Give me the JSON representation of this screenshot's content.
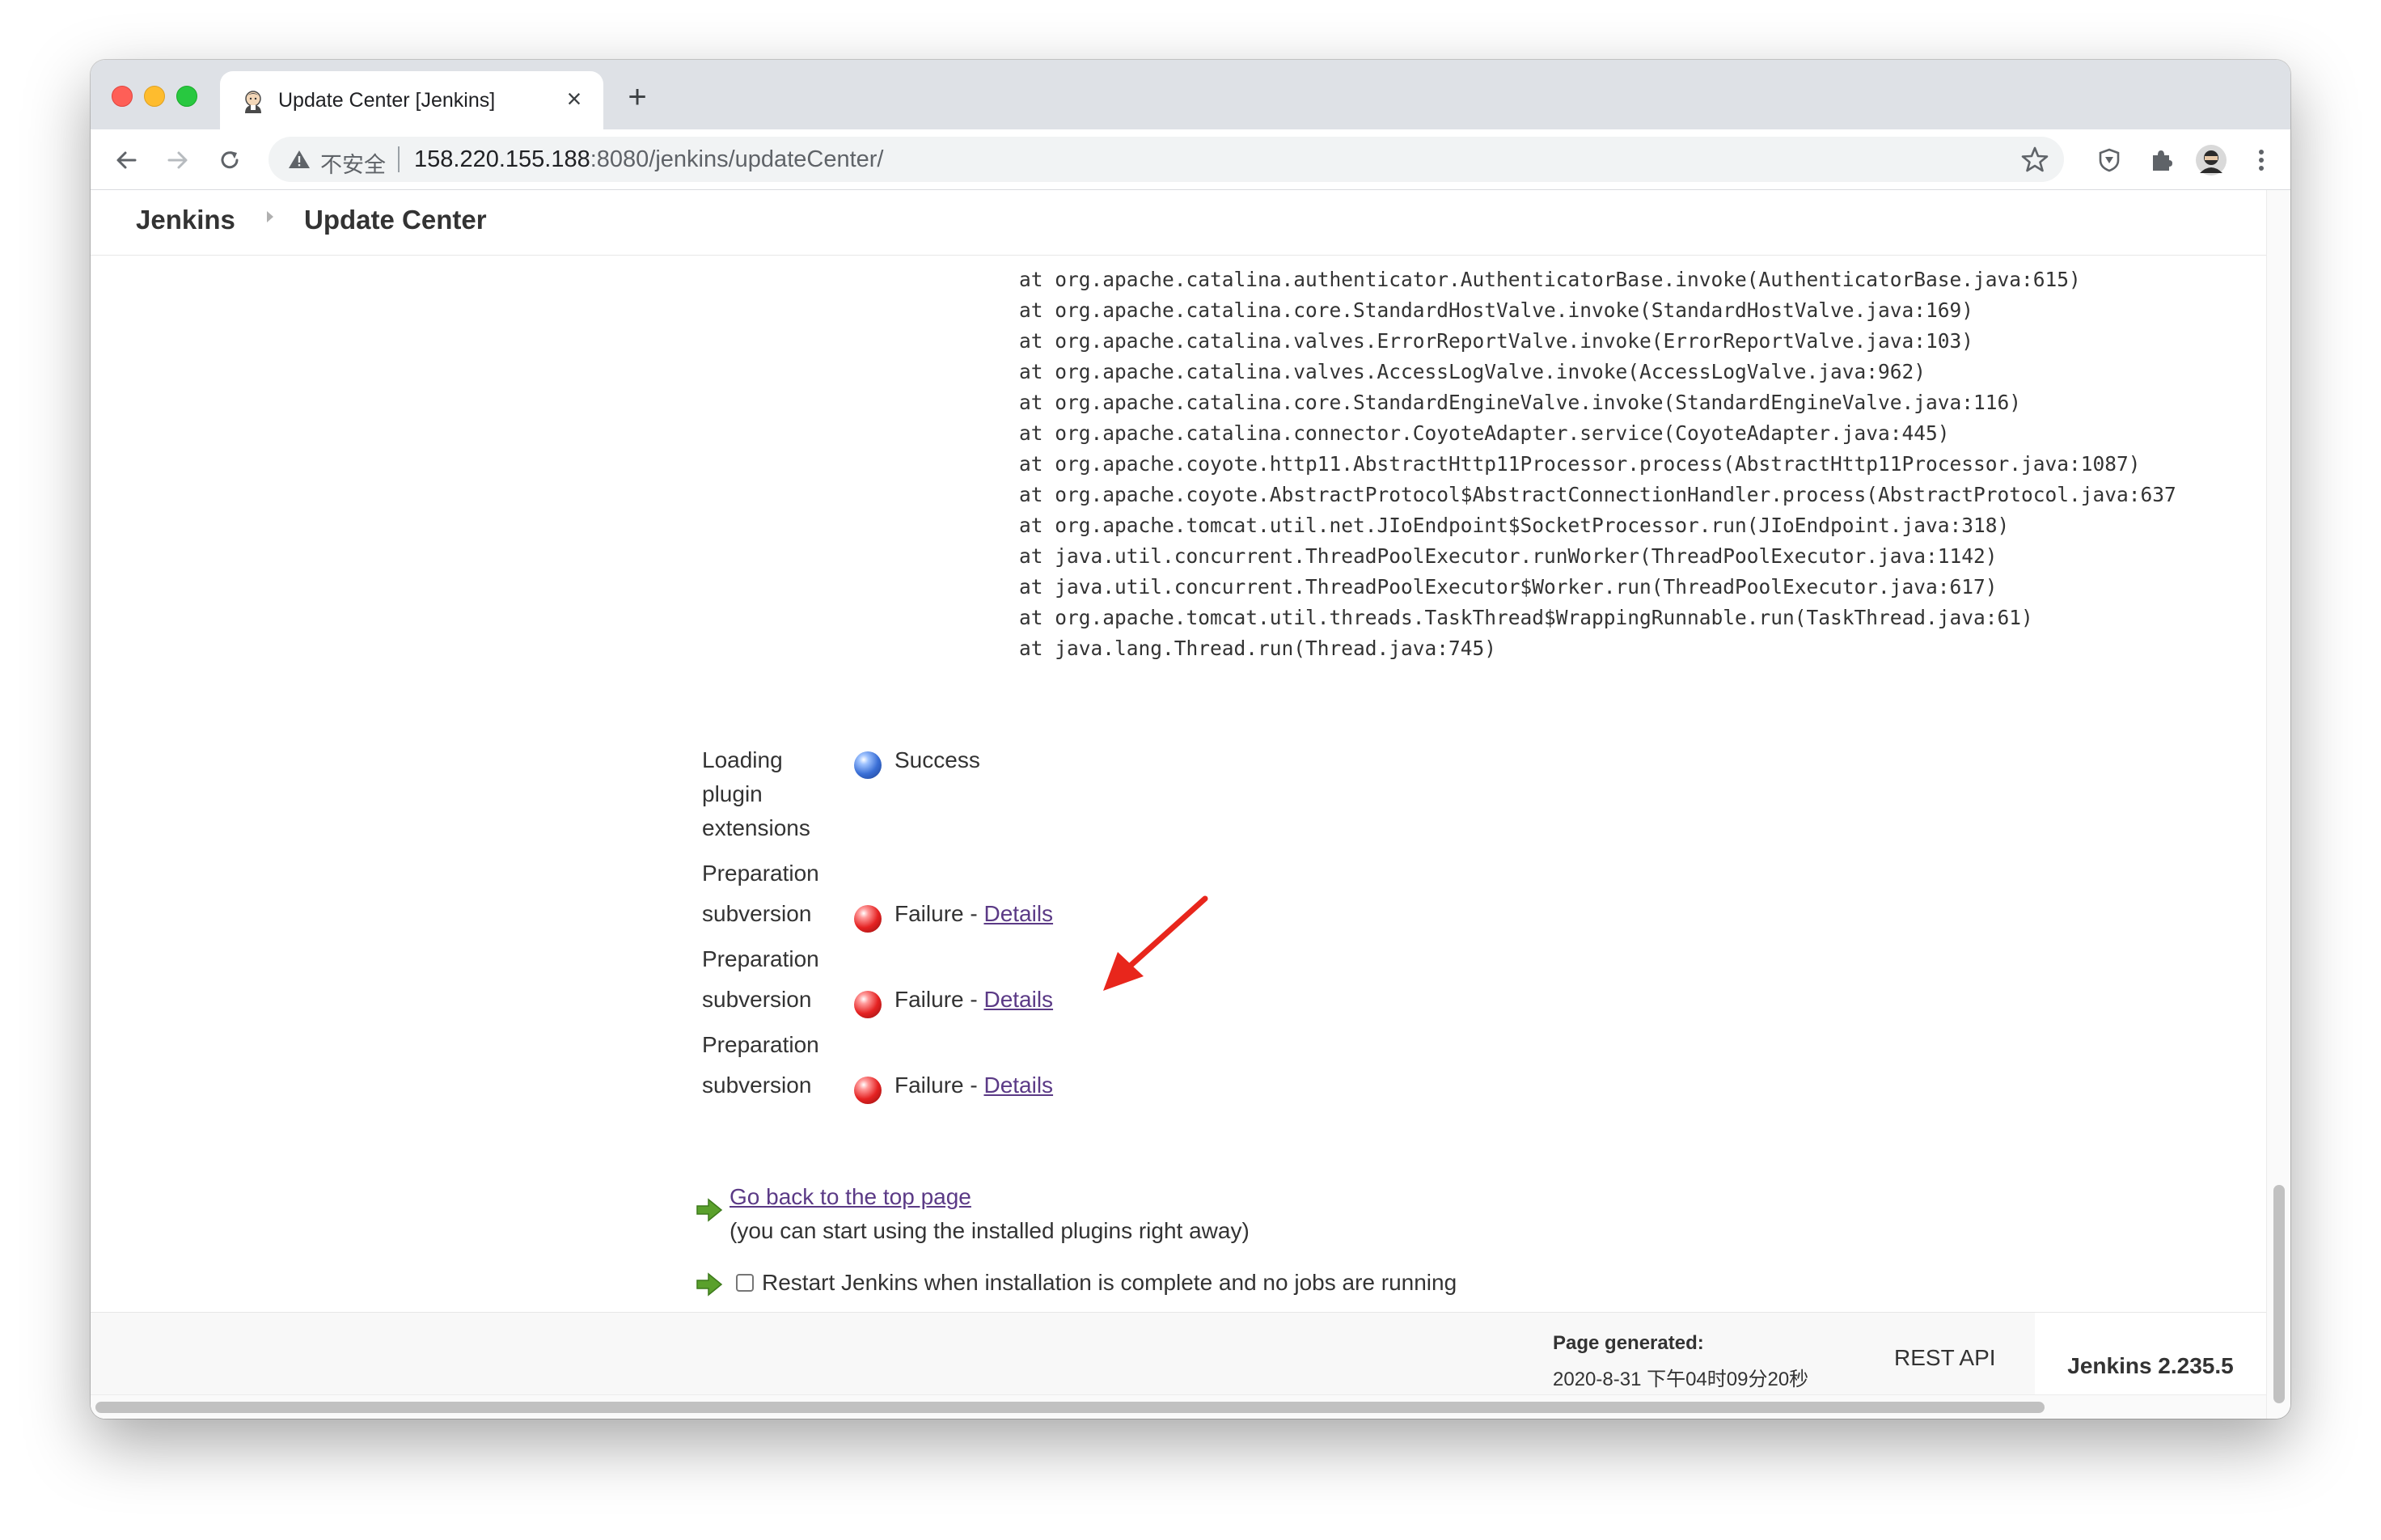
{
  "browser": {
    "tab_title": "Update Center [Jenkins]",
    "security_label": "不安全",
    "url_host": "158.220.155.188",
    "url_rest": ":8080/jenkins/updateCenter/"
  },
  "breadcrumb": {
    "root": "Jenkins",
    "current": "Update Center"
  },
  "stack_trace": "at org.apache.catalina.authenticator.AuthenticatorBase.invoke(AuthenticatorBase.java:615)\nat org.apache.catalina.core.StandardHostValve.invoke(StandardHostValve.java:169)\nat org.apache.catalina.valves.ErrorReportValve.invoke(ErrorReportValve.java:103)\nat org.apache.catalina.valves.AccessLogValve.invoke(AccessLogValve.java:962)\nat org.apache.catalina.core.StandardEngineValve.invoke(StandardEngineValve.java:116)\nat org.apache.catalina.connector.CoyoteAdapter.service(CoyoteAdapter.java:445)\nat org.apache.coyote.http11.AbstractHttp11Processor.process(AbstractHttp11Processor.java:1087)\nat org.apache.coyote.AbstractProtocol$AbstractConnectionHandler.process(AbstractProtocol.java:637\nat org.apache.tomcat.util.net.JIoEndpoint$SocketProcessor.run(JIoEndpoint.java:318)\nat java.util.concurrent.ThreadPoolExecutor.runWorker(ThreadPoolExecutor.java:1142)\nat java.util.concurrent.ThreadPoolExecutor$Worker.run(ThreadPoolExecutor.java:617)\nat org.apache.tomcat.util.threads.TaskThread$WrappingRunnable.run(TaskThread.java:61)\nat java.lang.Thread.run(Thread.java:745)",
  "jobs": {
    "loading": {
      "label_lines": [
        "Loading",
        "plugin",
        "extensions"
      ],
      "status": "Success",
      "status_color": "blue"
    },
    "failures": [
      {
        "label_top": "Preparation",
        "label_bottom": "subversion",
        "status": "Failure - ",
        "link": "Details",
        "status_color": "red"
      },
      {
        "label_top": "Preparation",
        "label_bottom": "subversion",
        "status": "Failure - ",
        "link": "Details",
        "status_color": "red"
      },
      {
        "label_top": "Preparation",
        "label_bottom": "subversion",
        "status": "Failure - ",
        "link": "Details",
        "status_color": "red"
      }
    ]
  },
  "actions": {
    "top_page_link": "Go back to the top page",
    "top_page_note": "(you can start using the installed plugins right away)",
    "restart_label": "Restart Jenkins when installation is complete and no jobs are running",
    "restart_checked": false
  },
  "footer": {
    "generated_label": "Page generated:",
    "generated_value": "2020-8-31 下午04时09分20秒",
    "rest_api": "REST API",
    "version": "Jenkins 2.235.5"
  },
  "colors": {
    "link": "#5b3a86",
    "annotation_arrow": "#e8261c",
    "arrow_icon": "#5aa02c"
  },
  "icons": [
    "back-icon",
    "forward-icon",
    "reload-icon",
    "warning-icon",
    "star-icon",
    "shield-extension-icon",
    "puzzle-icon",
    "profile-avatar",
    "menu-dots-icon",
    "green-arrow-icon"
  ]
}
